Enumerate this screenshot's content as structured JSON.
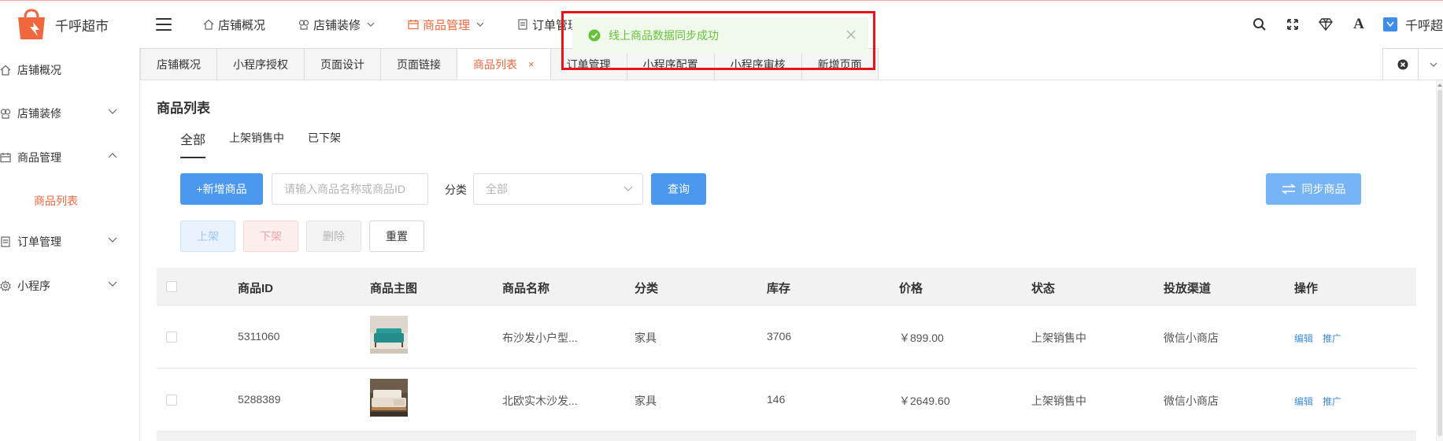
{
  "app": {
    "name": "千呼超市",
    "brand_color": "#f0673e"
  },
  "topnav": {
    "items": [
      {
        "label": "店铺概况",
        "icon": "home-icon",
        "dropdown": false
      },
      {
        "label": "店铺装修",
        "icon": "gift-icon",
        "dropdown": true
      },
      {
        "label": "商品管理",
        "icon": "calendar-icon",
        "dropdown": true,
        "active": true
      },
      {
        "label": "订单管理",
        "icon": "document-icon",
        "dropdown": false
      }
    ]
  },
  "header_tools": {
    "icons": [
      "search-icon",
      "fullscreen-icon",
      "diamond-icon",
      "font-icon"
    ],
    "font_label": "A",
    "user_name": "千呼超"
  },
  "sidebar": {
    "items": [
      {
        "label": "店铺概况",
        "icon": "home-icon"
      },
      {
        "label": "店铺装修",
        "icon": "gift-icon",
        "expanded": false
      },
      {
        "label": "商品管理",
        "icon": "calendar-icon",
        "expanded": true
      },
      {
        "label": "订单管理",
        "icon": "document-icon",
        "expanded": false
      },
      {
        "label": "小程序",
        "icon": "gear-icon",
        "expanded": false
      }
    ],
    "sub_item": "商品列表"
  },
  "tabs": [
    {
      "label": "店铺概况"
    },
    {
      "label": "小程序授权"
    },
    {
      "label": "页面设计"
    },
    {
      "label": "页面链接"
    },
    {
      "label": "商品列表",
      "active": true,
      "close": "×"
    },
    {
      "label": "订单管理"
    },
    {
      "label": "小程序配置"
    },
    {
      "label": "小程序审核"
    },
    {
      "label": "新增页面"
    }
  ],
  "main": {
    "title": "商品列表",
    "subtabs": [
      {
        "label": "全部",
        "active": true
      },
      {
        "label": "上架销售中"
      },
      {
        "label": "已下架"
      }
    ],
    "add_button": "+新增商品",
    "search_placeholder": "请输入商品名称或商品ID",
    "filter_label": "分类",
    "category_value": "全部",
    "query_button": "查询",
    "sync_button": "同步商品",
    "onshelf_button": "上架",
    "offshelf_button": "下架",
    "delete_button": "删除",
    "reset_button": "重置"
  },
  "table": {
    "columns": [
      "商品ID",
      "商品主图",
      "商品名称",
      "分类",
      "库存",
      "价格",
      "状态",
      "投放渠道",
      "操作"
    ],
    "rows": [
      {
        "id": "5311060",
        "name": "布沙发小户型...",
        "category": "家具",
        "stock": "3706",
        "price": "￥899.00",
        "status": "上架销售中",
        "channel": "微信小商店",
        "edit": "编辑",
        "promote": "推广",
        "image": "teal-sofa"
      },
      {
        "id": "5288389",
        "name": "北欧实木沙发...",
        "category": "家具",
        "stock": "146",
        "price": "￥2649.60",
        "status": "上架销售中",
        "channel": "微信小商店",
        "edit": "编辑",
        "promote": "推广",
        "image": "wood-sofa"
      }
    ]
  },
  "toast": {
    "message": "线上商品数据同步成功",
    "type": "success",
    "color": "#67c23a"
  }
}
